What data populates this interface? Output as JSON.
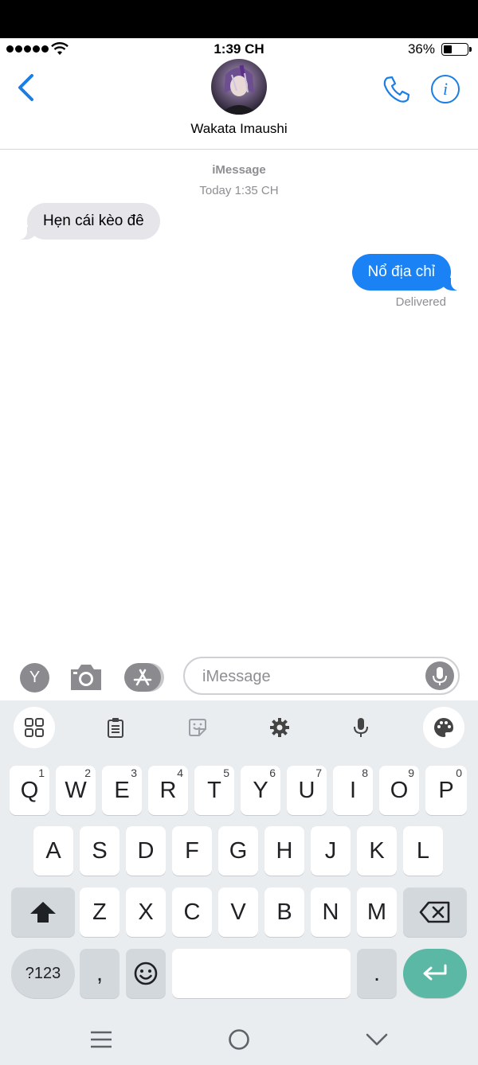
{
  "status_bar": {
    "time": "1:39 CH",
    "battery": "36%"
  },
  "header": {
    "contact_name": "Wakata Imaushi"
  },
  "conversation": {
    "service": "iMessage",
    "timestamp": "Today 1:35 CH",
    "messages": [
      {
        "direction": "incoming",
        "text": "Hẹn cái kèo đê"
      },
      {
        "direction": "outgoing",
        "text": "Nổ địa chỉ"
      }
    ],
    "delivery_status": "Delivered"
  },
  "input": {
    "placeholder": "iMessage",
    "app_button_letter": "Y"
  },
  "keyboard": {
    "row1": [
      {
        "key": "Q",
        "hint": "1"
      },
      {
        "key": "W",
        "hint": "2"
      },
      {
        "key": "E",
        "hint": "3"
      },
      {
        "key": "R",
        "hint": "4"
      },
      {
        "key": "T",
        "hint": "5"
      },
      {
        "key": "Y",
        "hint": "6"
      },
      {
        "key": "U",
        "hint": "7"
      },
      {
        "key": "I",
        "hint": "8"
      },
      {
        "key": "O",
        "hint": "9"
      },
      {
        "key": "P",
        "hint": "0"
      }
    ],
    "row2": [
      "A",
      "S",
      "D",
      "F",
      "G",
      "H",
      "J",
      "K",
      "L"
    ],
    "row3": [
      "Z",
      "X",
      "C",
      "V",
      "B",
      "N",
      "M"
    ],
    "symbols_label": "?123",
    "comma": ",",
    "period": "."
  },
  "colors": {
    "accent_blue": "#1a82f5",
    "enter_key": "#5ab8a4",
    "incoming_bubble": "#e5e5ea"
  }
}
